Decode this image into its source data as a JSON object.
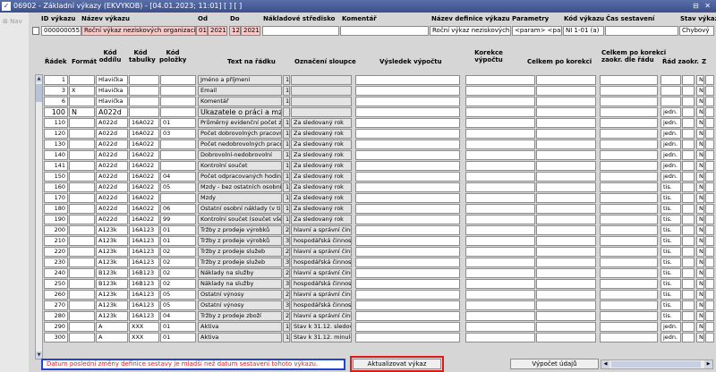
{
  "window": {
    "title": "06902 - Základní výkazy (EKVYKOB) - [04.01.2023; 11:01] [ ] [ ]",
    "icon": "app-icon",
    "controls": "⊟ ✕"
  },
  "nav": {
    "label": "Nav"
  },
  "header": {
    "labels": {
      "id": "ID výkazu",
      "name": "Název výkazu",
      "from": "Od",
      "to": "Do",
      "cost_center": "Nákladové středisko",
      "comment": "Komentář",
      "def_name": "Název definice výkazu",
      "params": "Parametry",
      "code": "Kód výkazu",
      "time": "Čas sestavení",
      "state": "Stav výkazu"
    },
    "values": {
      "id": "0000000555",
      "name": "Roční výkaz neziskových organizací,",
      "from_m": "01",
      "from_y": "2021",
      "to_m": "12",
      "to_y": "2021",
      "cost_center": "",
      "comment": "",
      "def_name": "Roční výkaz neziskových o",
      "params": "<param> <parai",
      "code": "NI 1-01 (a)",
      "time": "",
      "state": "Chybový"
    }
  },
  "columns": {
    "radek": "Řádek",
    "format": "Formát",
    "kod_oddilu": "Kód oddílu",
    "kod_tabulky": "Kód tabulky",
    "kod_polozky": "Kód položky",
    "text": "Text na řádku",
    "oznaceni": "Označení sloupce",
    "vysledek": "Výsledek výpočtu",
    "korekce": "Korekce výpočtu",
    "celkem": "Celkem po korekci",
    "celkem_zaokr": "Celkem po korekci zaokr. dle řádu",
    "rad": "Řád zaokr.",
    "z": "Z"
  },
  "rows": [
    {
      "radek": "1",
      "format": "",
      "oddil": "Hlavička",
      "tabulka": "",
      "polozka": "",
      "text": "Jméno a příjmení",
      "num": "1",
      "oznaceni": "",
      "rad": "",
      "z": "N"
    },
    {
      "radek": "3",
      "format": "X",
      "oddil": "Hlavička",
      "tabulka": "",
      "polozka": "",
      "text": "Email",
      "num": "1",
      "oznaceni": "",
      "rad": "",
      "z": "N"
    },
    {
      "radek": "6",
      "format": "",
      "oddil": "Hlavička",
      "tabulka": "",
      "polozka": "",
      "text": "Komentář",
      "num": "1",
      "oznaceni": "",
      "rad": "",
      "z": "N"
    },
    {
      "radek": "100",
      "format": "N",
      "oddil": "A022d",
      "tabulka": "",
      "polozka": "",
      "text": "Ukazatele o práci a mzdách",
      "num": "",
      "oznaceni": "",
      "rad": "jedn.",
      "z": "N",
      "big": true
    },
    {
      "radek": "110",
      "format": "",
      "oddil": "A022d",
      "tabulka": "16A022",
      "polozka": "01",
      "text": "Průměrný evidenční počet zaměstnanců",
      "num": "1",
      "oznaceni": "Za sledovaný rok",
      "rad": "jedn.",
      "z": "N"
    },
    {
      "radek": "120",
      "format": "",
      "oddil": "A022d",
      "tabulka": "16A022",
      "polozka": "03",
      "text": "Počet dobrovolných pracovníků",
      "num": "1",
      "oznaceni": "Za sledovaný rok",
      "rad": "jedn.",
      "z": "N"
    },
    {
      "radek": "130",
      "format": "",
      "oddil": "A022d",
      "tabulka": "16A022",
      "polozka": "",
      "text": "Počet nedobrovolných pracovníků",
      "num": "1",
      "oznaceni": "Za sledovaný rok",
      "rad": "jedn.",
      "z": "N"
    },
    {
      "radek": "140",
      "format": "",
      "oddil": "A022d",
      "tabulka": "16A022",
      "polozka": "",
      "text": "Dobrovolní-nedobrovolní",
      "num": "1",
      "oznaceni": "Za sledovaný rok",
      "rad": "jedn.",
      "z": "N"
    },
    {
      "radek": "141",
      "format": "",
      "oddil": "A022d",
      "tabulka": "16A022",
      "polozka": "",
      "text": "Kontrolní součet",
      "num": "1",
      "oznaceni": "Za sledovaný rok",
      "rad": "jedn.",
      "z": "N"
    },
    {
      "radek": "150",
      "format": "",
      "oddil": "A022d",
      "tabulka": "16A022",
      "polozka": "04",
      "text": "Počet odpracovaných hodin",
      "num": "1",
      "oznaceni": "Za sledovaný rok",
      "rad": "jedn.",
      "z": "N"
    },
    {
      "radek": "160",
      "format": "",
      "oddil": "A022d",
      "tabulka": "16A022",
      "polozka": "05",
      "text": "Mzdy - bez ostatních osobních nákladů",
      "num": "1",
      "oznaceni": "Za sledovaný rok",
      "rad": "tis.",
      "z": "N"
    },
    {
      "radek": "170",
      "format": "",
      "oddil": "A022d",
      "tabulka": "16A022",
      "polozka": "",
      "text": "Mzdy",
      "num": "1",
      "oznaceni": "Za sledovaný rok",
      "rad": "tis.",
      "z": "N"
    },
    {
      "radek": "180",
      "format": "",
      "oddil": "A022d",
      "tabulka": "16A022",
      "polozka": "06",
      "text": "Ostatní osobní náklady (v tis.)",
      "num": "1",
      "oznaceni": "Za sledovaný rok",
      "rad": "tis.",
      "z": "N"
    },
    {
      "radek": "190",
      "format": "",
      "oddil": "A022d",
      "tabulka": "16A022",
      "polozka": "99",
      "text": "Kontrolní součet (součet všech)",
      "num": "1",
      "oznaceni": "Za sledovaný rok",
      "rad": "tis.",
      "z": "N"
    },
    {
      "radek": "200",
      "format": "",
      "oddil": "A123k",
      "tabulka": "16A123",
      "polozka": "01",
      "text": "Tržby z prodeje výrobků",
      "num": "2",
      "oznaceni": "hlavní a správní činnost",
      "rad": "tis.",
      "z": "N"
    },
    {
      "radek": "210",
      "format": "",
      "oddil": "A123k",
      "tabulka": "16A123",
      "polozka": "01",
      "text": "Tržby z prodeje výrobků",
      "num": "3",
      "oznaceni": "hospodářská činnost",
      "rad": "tis.",
      "z": "N"
    },
    {
      "radek": "220",
      "format": "",
      "oddil": "A123k",
      "tabulka": "16A123",
      "polozka": "02",
      "text": "Tržby z prodeje služeb",
      "num": "2",
      "oznaceni": "hlavní a správní činnost",
      "rad": "tis.",
      "z": "N"
    },
    {
      "radek": "230",
      "format": "",
      "oddil": "A123k",
      "tabulka": "16A123",
      "polozka": "02",
      "text": "Tržby z prodeje služeb",
      "num": "3",
      "oznaceni": "hospodářská činnost",
      "rad": "tis.",
      "z": "N"
    },
    {
      "radek": "240",
      "format": "",
      "oddil": "B123k",
      "tabulka": "16B123",
      "polozka": "02",
      "text": "Náklady na služby",
      "num": "2",
      "oznaceni": "hlavní a správní činnost",
      "rad": "tis.",
      "z": "N"
    },
    {
      "radek": "250",
      "format": "",
      "oddil": "B123k",
      "tabulka": "16B123",
      "polozka": "02",
      "text": "Náklady na služby",
      "num": "3",
      "oznaceni": "hospodářská činnost",
      "rad": "tis.",
      "z": "N"
    },
    {
      "radek": "260",
      "format": "",
      "oddil": "A123k",
      "tabulka": "16A123",
      "polozka": "05",
      "text": "Ostatní výnosy",
      "num": "2",
      "oznaceni": "hlavní a správní činnost",
      "rad": "tis.",
      "z": "N"
    },
    {
      "radek": "270",
      "format": "",
      "oddil": "A123k",
      "tabulka": "16A123",
      "polozka": "05",
      "text": "Ostatní výnosy",
      "num": "3",
      "oznaceni": "hospodářská činnost",
      "rad": "tis.",
      "z": "N"
    },
    {
      "radek": "280",
      "format": "",
      "oddil": "A123k",
      "tabulka": "16A123",
      "polozka": "04",
      "text": "Tržby z prodeje zboží",
      "num": "2",
      "oznaceni": "hlavní a správní činnost",
      "rad": "tis.",
      "z": "N"
    },
    {
      "radek": "290",
      "format": "",
      "oddil": "A",
      "tabulka": "XXX",
      "polozka": "01",
      "text": "Aktiva",
      "num": "1",
      "oznaceni": "Stav k 31.12. sledovaného roku",
      "rad": "jedn.",
      "z": "N"
    },
    {
      "radek": "300",
      "format": "",
      "oddil": "A",
      "tabulka": "XXX",
      "polozka": "01",
      "text": "Aktiva",
      "num": "1",
      "oznaceni": "Stav k 31.12. minulého roku",
      "rad": "jedn.",
      "z": "N"
    }
  ],
  "footer": {
    "warning": "Datum poslední změny definice sestavy je mladší než datum sestavení tohoto výkazu.",
    "update_button": "Aktualizovat výkaz",
    "calc_button": "Výpočet údajů"
  },
  "colors": {
    "accent_red": "#e01818",
    "warning_text": "#e02020",
    "warning_border": "#2244cc",
    "pink_field": "#f7c9c9"
  }
}
